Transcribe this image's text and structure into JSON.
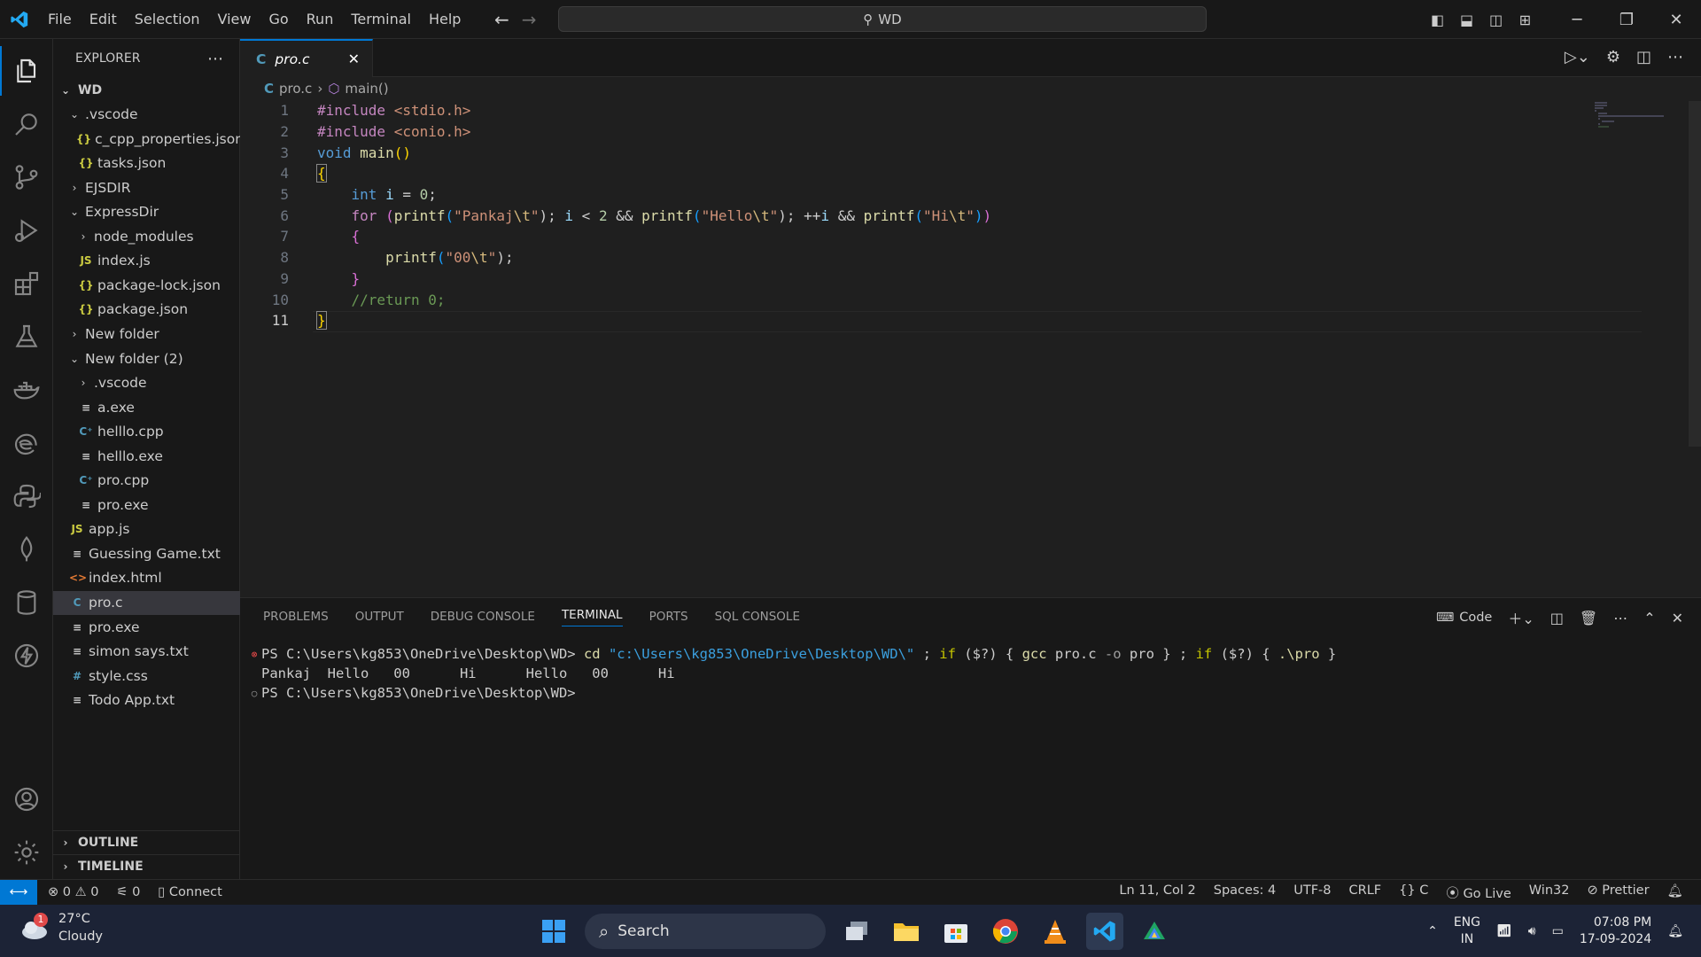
{
  "titlebar": {
    "menus": [
      "File",
      "Edit",
      "Selection",
      "View",
      "Go",
      "Run",
      "Terminal",
      "Help"
    ],
    "search_text": "WD"
  },
  "sidebar": {
    "title": "EXPLORER",
    "root": "WD",
    "items": [
      {
        "label": ".vscode",
        "type": "folder-open",
        "depth": 1
      },
      {
        "label": "c_cpp_properties.json",
        "type": "json",
        "depth": 2
      },
      {
        "label": "tasks.json",
        "type": "json",
        "depth": 2
      },
      {
        "label": "EJSDIR",
        "type": "folder",
        "depth": 1
      },
      {
        "label": "ExpressDir",
        "type": "folder-open",
        "depth": 1
      },
      {
        "label": "node_modules",
        "type": "folder",
        "depth": 2
      },
      {
        "label": "index.js",
        "type": "js",
        "depth": 2
      },
      {
        "label": "package-lock.json",
        "type": "json",
        "depth": 2
      },
      {
        "label": "package.json",
        "type": "json",
        "depth": 2
      },
      {
        "label": "New folder",
        "type": "folder",
        "depth": 1
      },
      {
        "label": "New folder (2)",
        "type": "folder-open",
        "depth": 1
      },
      {
        "label": ".vscode",
        "type": "folder",
        "depth": 2
      },
      {
        "label": "a.exe",
        "type": "exe",
        "depth": 2
      },
      {
        "label": "helllo.cpp",
        "type": "cpp",
        "depth": 2
      },
      {
        "label": "helllo.exe",
        "type": "exe",
        "depth": 2
      },
      {
        "label": "pro.cpp",
        "type": "cpp",
        "depth": 2
      },
      {
        "label": "pro.exe",
        "type": "exe",
        "depth": 2
      },
      {
        "label": "app.js",
        "type": "js",
        "depth": 1
      },
      {
        "label": "Guessing Game.txt",
        "type": "txt",
        "depth": 1
      },
      {
        "label": "index.html",
        "type": "html",
        "depth": 1
      },
      {
        "label": "pro.c",
        "type": "c",
        "depth": 1,
        "selected": true
      },
      {
        "label": "pro.exe",
        "type": "exe",
        "depth": 1
      },
      {
        "label": "simon says.txt",
        "type": "txt",
        "depth": 1
      },
      {
        "label": "style.css",
        "type": "css",
        "depth": 1
      },
      {
        "label": "Todo App.txt",
        "type": "txt",
        "depth": 1
      }
    ],
    "outline_label": "OUTLINE",
    "timeline_label": "TIMELINE"
  },
  "editor": {
    "tab_label": "pro.c",
    "tab_icon": "C",
    "breadcrumb_file": "pro.c",
    "breadcrumb_symbol": "main()",
    "line_numbers": [
      "1",
      "2",
      "3",
      "4",
      "5",
      "6",
      "7",
      "8",
      "9",
      "10",
      "11"
    ],
    "code": {
      "l1": [
        "#include",
        " <stdio.h>"
      ],
      "l2": [
        "#include",
        " <conio.h>"
      ],
      "l3": [
        "void",
        " ",
        "main",
        "()"
      ],
      "l4": [
        "{"
      ],
      "l5": [
        "    ",
        "int",
        " ",
        "i",
        " = ",
        "0",
        ";"
      ],
      "l6": [
        "    ",
        "for",
        " ",
        "(",
        "printf",
        "(",
        "\"Pankaj",
        "\\t",
        "\"",
        "); ",
        "i",
        " < ",
        "2",
        " && ",
        "printf",
        "(",
        "\"Hello",
        "\\t",
        "\"",
        "); ++",
        "i",
        " && ",
        "printf",
        "(",
        "\"Hi",
        "\\t",
        "\"",
        ")",
        ")"
      ],
      "l7": [
        "    ",
        "{"
      ],
      "l8": [
        "        ",
        "printf",
        "(",
        "\"00",
        "\\t",
        "\"",
        ");"
      ],
      "l9": [
        "    ",
        "}"
      ],
      "l10": [
        "    ",
        "//return 0;"
      ],
      "l11": [
        "}"
      ]
    }
  },
  "panel": {
    "tabs": [
      "PROBLEMS",
      "OUTPUT",
      "DEBUG CONSOLE",
      "TERMINAL",
      "PORTS",
      "SQL CONSOLE"
    ],
    "active_tab": "TERMINAL",
    "shell_label": "Code",
    "terminal": {
      "prompt": "PS C:\\Users\\kg853\\OneDrive\\Desktop\\WD>",
      "cmd_cd": "cd",
      "cmd_path": "\"c:\\Users\\kg853\\OneDrive\\Desktop\\WD\\\"",
      "cmd_sep1": " ; ",
      "cmd_if1": "if",
      "cmd_mid1": " ($?) { ",
      "cmd_gcc": "gcc",
      "cmd_gccargs": " pro.c ",
      "cmd_opt": "-o",
      "cmd_out": " pro } ; ",
      "cmd_if2": "if",
      "cmd_mid2": " ($?) { ",
      "cmd_run": ".\\pro",
      "cmd_end": " }",
      "output": "Pankaj  Hello   00      Hi      Hello   00      Hi",
      "prompt2": "PS C:\\Users\\kg853\\OneDrive\\Desktop\\WD>"
    }
  },
  "statusbar": {
    "errors": "0",
    "warnings": "0",
    "ports": "0",
    "connect": "Connect",
    "position": "Ln 11, Col 2",
    "spaces": "Spaces: 4",
    "encoding": "UTF-8",
    "eol": "CRLF",
    "language": "C",
    "golive": "Go Live",
    "platform": "Win32",
    "prettier": "Prettier"
  },
  "taskbar": {
    "weather_temp": "27°C",
    "weather_desc": "Cloudy",
    "weather_badge": "1",
    "search_label": "Search",
    "lang_top": "ENG",
    "lang_bottom": "IN",
    "time": "07:08 PM",
    "date": "17-09-2024"
  },
  "colors": {
    "accent": "#0078d4",
    "editor_bg": "#1f1f1f",
    "chrome_bg": "#181818",
    "taskbar_bg": "#1c2336"
  }
}
